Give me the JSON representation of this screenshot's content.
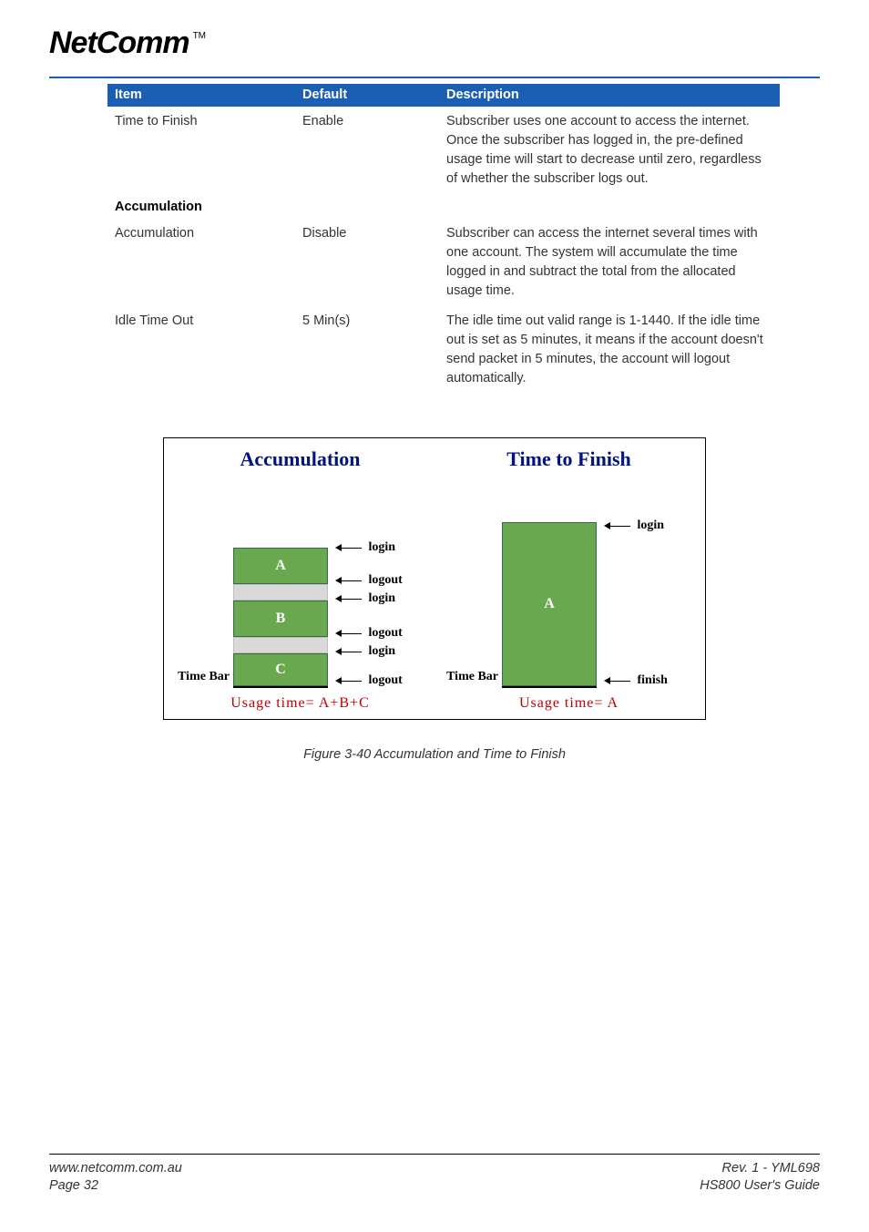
{
  "logo": {
    "text": "NetComm",
    "tm": "TM"
  },
  "table": {
    "headers": {
      "item": "Item",
      "default": "Default",
      "description": "Description"
    },
    "rows": [
      {
        "item": "Time to Finish",
        "default": "Enable",
        "description": "Subscriber uses one account to access the internet. Once the subscriber has logged in, the pre-defined usage time will start to decrease until zero, regardless of whether the subscriber logs out."
      },
      {
        "section": "Accumulation"
      },
      {
        "item": "Accumulation",
        "default": "Disable",
        "description": "Subscriber can access the internet several times with one account. The system will accumulate the time logged in and subtract the total from the allocated usage time."
      },
      {
        "item": "Idle Time Out",
        "default": "5 Min(s)",
        "description": "The idle time out valid range is 1-1440. If the idle time out is set as 5 minutes, it means if the account doesn't send packet in 5 minutes, the account will logout automatically."
      }
    ]
  },
  "diagram": {
    "left": {
      "title": "Accumulation",
      "ylabel": "Time Bar",
      "segments": [
        "A",
        "B",
        "C"
      ],
      "events": [
        "login",
        "logout",
        "login",
        "logout",
        "login",
        "logout"
      ],
      "formula": "Usage time= A+B+C"
    },
    "right": {
      "title": "Time to Finish",
      "ylabel": "Time Bar",
      "segments": [
        "A"
      ],
      "events": [
        "login",
        "finish"
      ],
      "formula": "Usage time= A"
    }
  },
  "caption": "Figure 3-40 Accumulation and Time to Finish",
  "footer": {
    "url": "www.netcomm.com.au",
    "page": "Page 32",
    "rev": "Rev. 1 - YML698",
    "guide": "HS800 User's Guide"
  },
  "chart_data": [
    {
      "type": "bar",
      "title": "Accumulation",
      "ylabel": "Time Bar",
      "categories": [
        "A (login→logout)",
        "gap",
        "B (login→logout)",
        "gap",
        "C (login→logout)"
      ],
      "values": [
        40,
        18,
        40,
        18,
        36
      ],
      "annotations": [
        "login",
        "logout",
        "login",
        "logout",
        "login",
        "logout"
      ],
      "formula": "Usage time = A + B + C"
    },
    {
      "type": "bar",
      "title": "Time to Finish",
      "ylabel": "Time Bar",
      "categories": [
        "A (login→finish)"
      ],
      "values": [
        180
      ],
      "annotations": [
        "login",
        "finish"
      ],
      "formula": "Usage time = A"
    }
  ]
}
